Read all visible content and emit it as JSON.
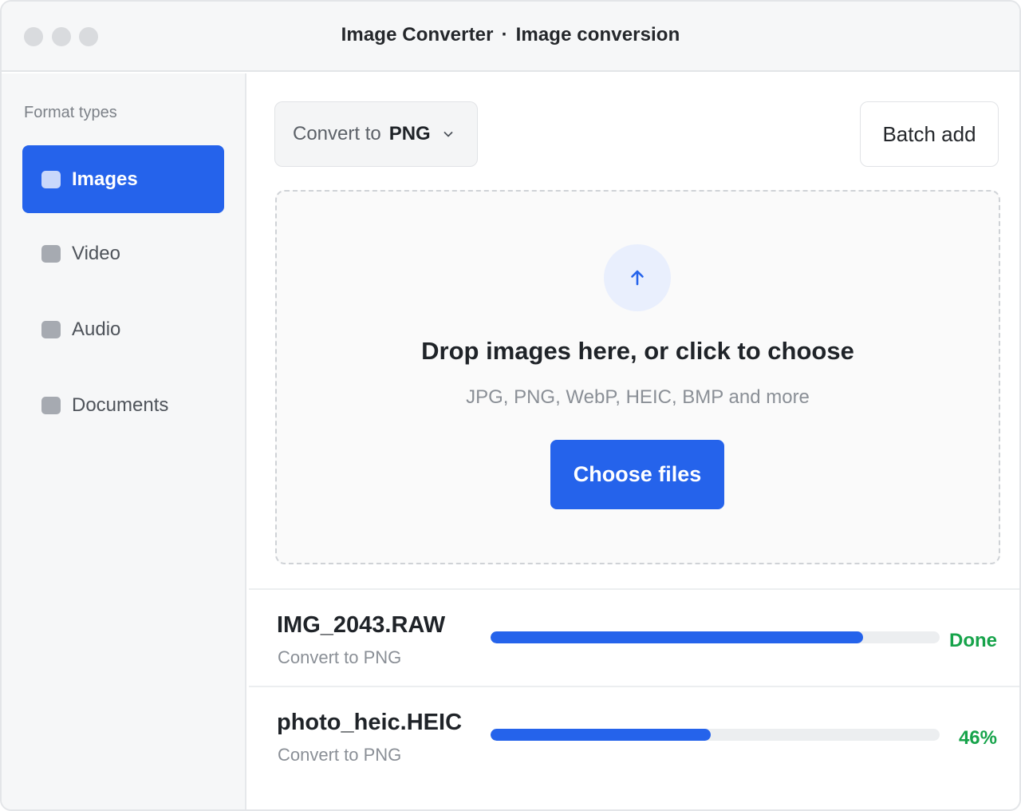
{
  "window": {
    "app_name": "Image Converter",
    "separator": "·",
    "section": "Image conversion"
  },
  "sidebar": {
    "heading": "Format types",
    "items": [
      {
        "label": "Images",
        "active": true
      },
      {
        "label": "Video",
        "active": false
      },
      {
        "label": "Audio",
        "active": false
      },
      {
        "label": "Documents",
        "active": false
      }
    ]
  },
  "toolbar": {
    "convert_prefix": "Convert to",
    "convert_format": "PNG",
    "batch_add_label": "Batch add"
  },
  "dropzone": {
    "title": "Drop images here, or click to choose",
    "subtitle": "JPG, PNG, WebP, HEIC, BMP and more",
    "button_label": "Choose files",
    "icon": "arrow-up-icon"
  },
  "files": [
    {
      "name": "IMG_2043.RAW",
      "meta": "Convert to PNG",
      "progress": 0.83,
      "status": "Done"
    },
    {
      "name": "photo_heic.HEIC",
      "meta": "Convert to PNG",
      "progress": 0.49,
      "status": "46%"
    }
  ],
  "colors": {
    "accent": "#2563eb",
    "success": "#16a34a",
    "sidebar_bg": "#f6f7f8"
  }
}
